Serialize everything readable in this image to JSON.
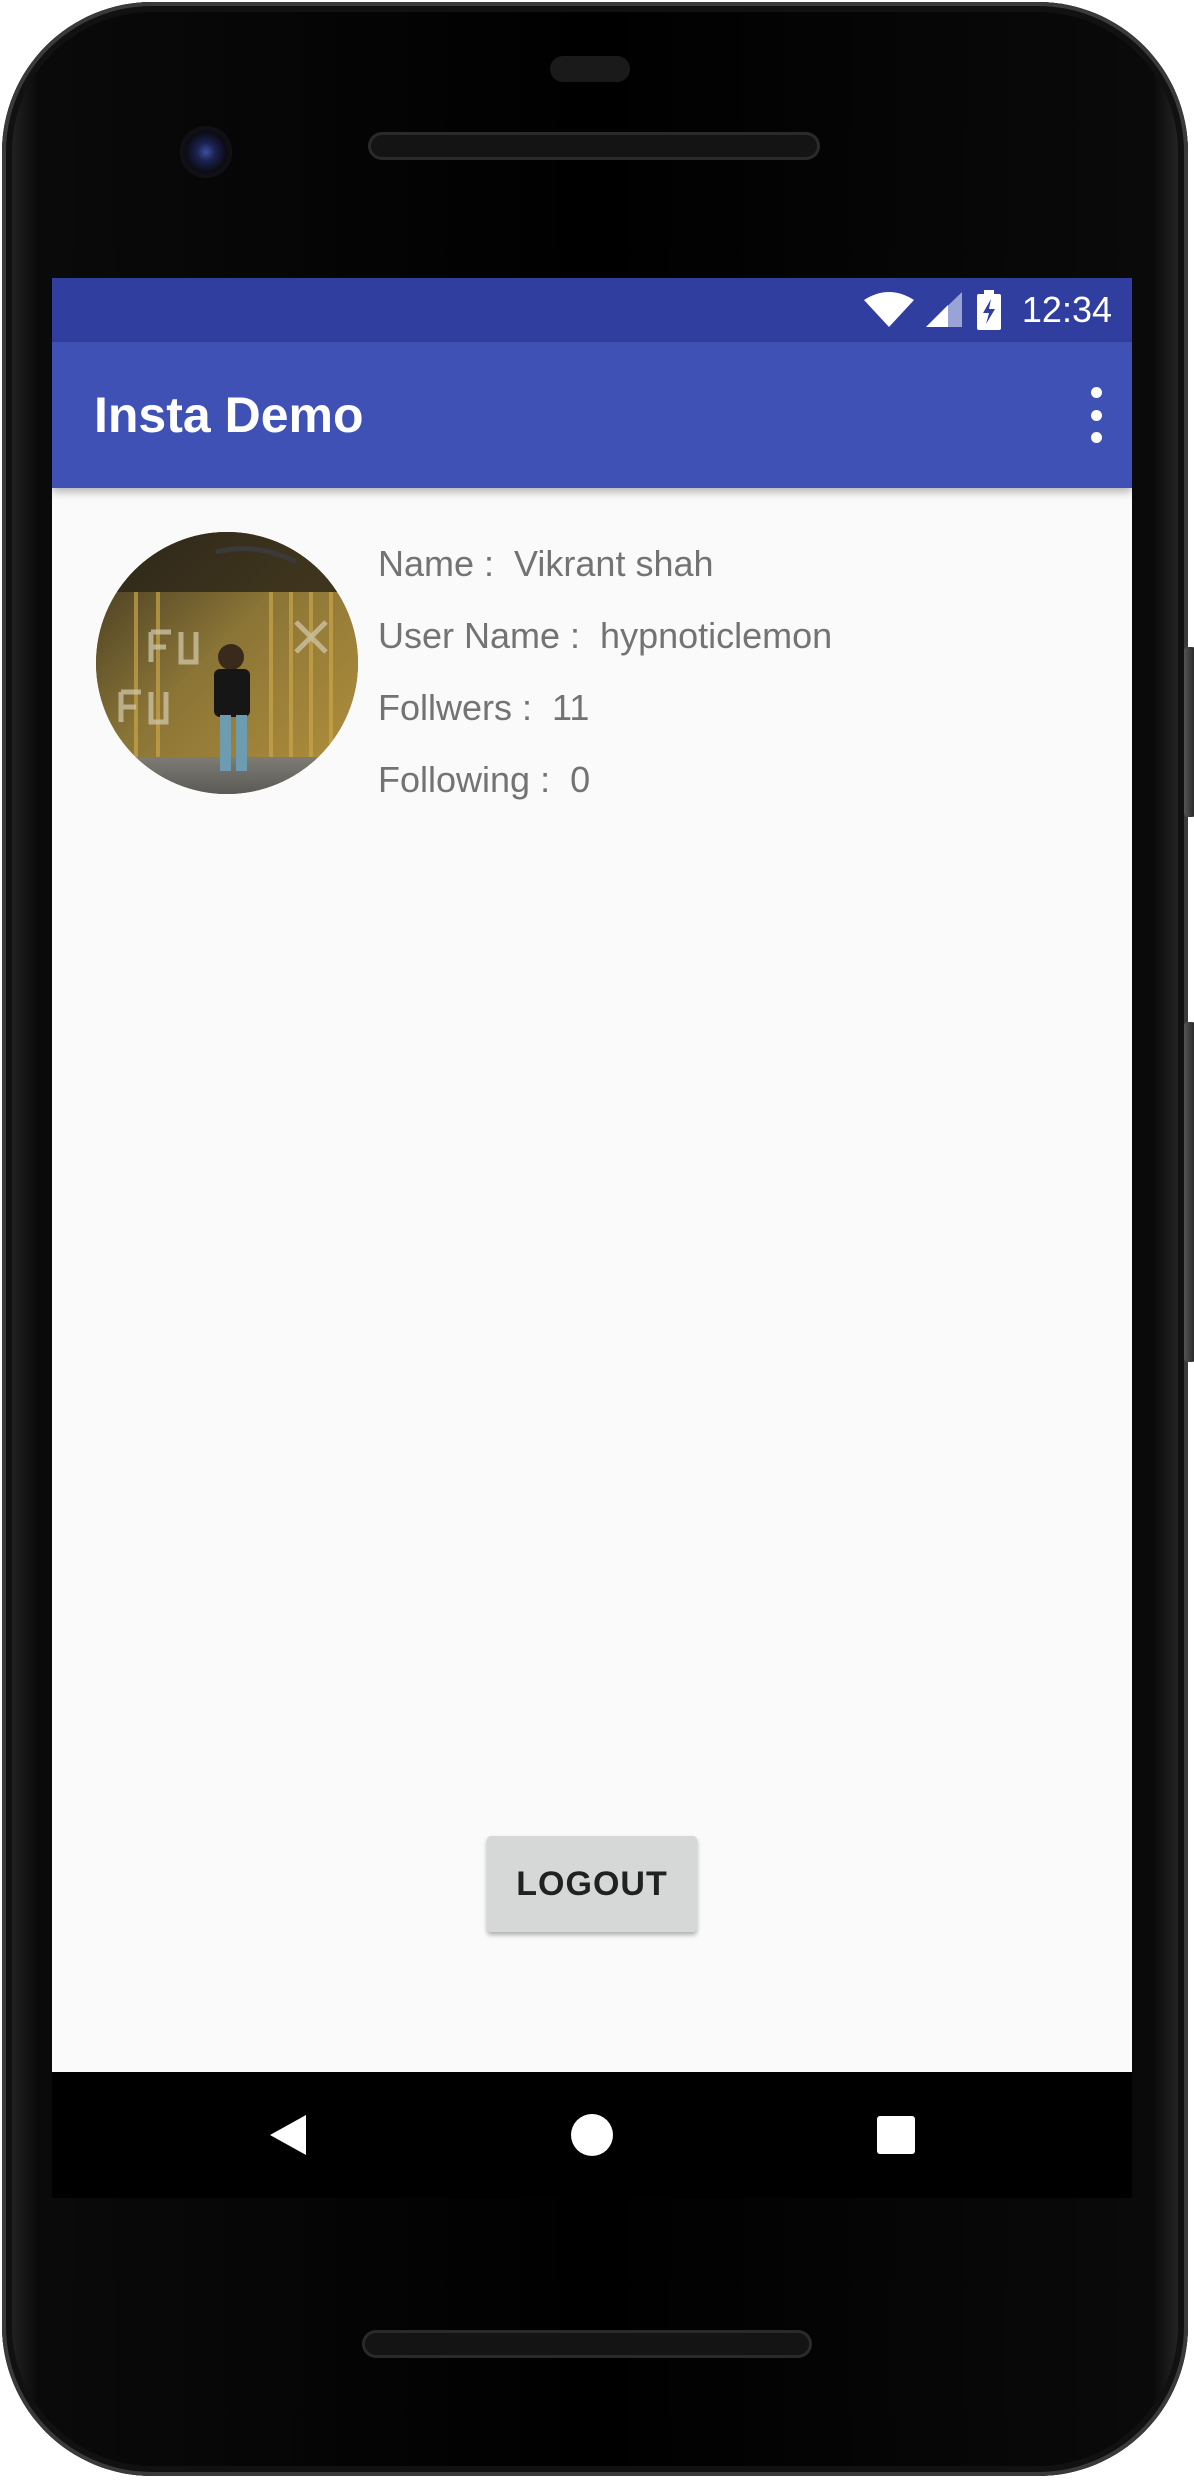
{
  "status_bar": {
    "time": "12:34",
    "icons": [
      "wifi-icon",
      "cell-signal-icon",
      "battery-charging-icon"
    ],
    "color": "#303f9f"
  },
  "app_bar": {
    "title": "Insta Demo",
    "menu_icon": "more-vert-icon",
    "color": "#3f51b5"
  },
  "profile": {
    "avatar_icon": "profile-photo",
    "fields": [
      {
        "label": "Name :",
        "value": "Vikrant shah"
      },
      {
        "label": "User Name :",
        "value": "hypnoticlemon"
      },
      {
        "label": "Follwers :",
        "value": "11"
      },
      {
        "label": "Following :",
        "value": "0"
      }
    ]
  },
  "actions": {
    "logout_label": "LOGOUT"
  },
  "nav_bar": {
    "buttons": [
      "back-icon",
      "home-icon",
      "recents-icon"
    ]
  }
}
